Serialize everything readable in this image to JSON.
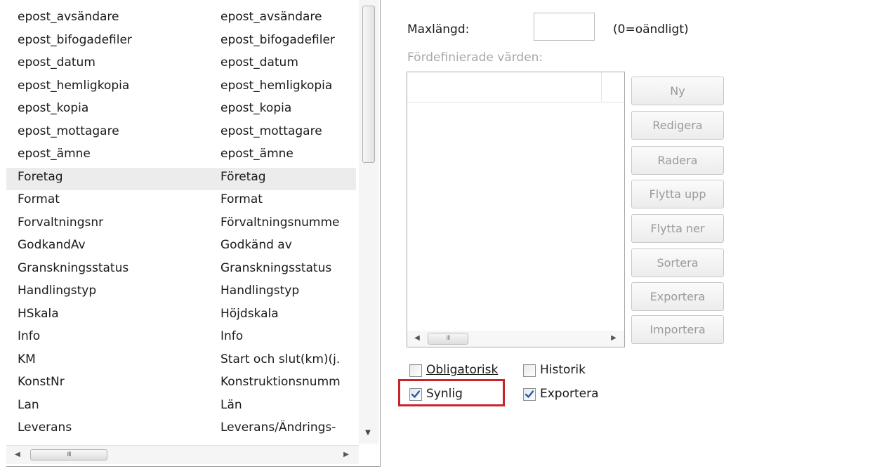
{
  "fields_list": {
    "rows": [
      {
        "name": "epost_avsändare",
        "display": "epost_avsändare"
      },
      {
        "name": "epost_bifogadefiler",
        "display": "epost_bifogadefiler"
      },
      {
        "name": "epost_datum",
        "display": "epost_datum"
      },
      {
        "name": "epost_hemligkopia",
        "display": "epost_hemligkopia"
      },
      {
        "name": "epost_kopia",
        "display": "epost_kopia"
      },
      {
        "name": "epost_mottagare",
        "display": "epost_mottagare"
      },
      {
        "name": "epost_ämne",
        "display": "epost_ämne"
      },
      {
        "name": "Foretag",
        "display": "Företag"
      },
      {
        "name": "Format",
        "display": "Format"
      },
      {
        "name": "Forvaltningsnr",
        "display": "Förvaltningsnumme"
      },
      {
        "name": "GodkandAv",
        "display": "Godkänd av"
      },
      {
        "name": "Granskningsstatus",
        "display": "Granskningsstatus"
      },
      {
        "name": "Handlingstyp",
        "display": "Handlingstyp"
      },
      {
        "name": "HSkala",
        "display": "Höjdskala"
      },
      {
        "name": "Info",
        "display": "Info"
      },
      {
        "name": "KM",
        "display": "Start och slut(km)(j."
      },
      {
        "name": "KonstNr",
        "display": "Konstruktionsnumm"
      },
      {
        "name": "Lan",
        "display": "Län"
      },
      {
        "name": "Leverans",
        "display": "Leverans/Ändrings-"
      }
    ],
    "selected_index": 7,
    "hscroll_thumb_glyph": "III"
  },
  "settings": {
    "maxlength_label": "Maxlängd:",
    "maxlength_value": "",
    "maxlength_hint": "(0=oändligt)",
    "predefined_label": "Fördefinierade värden:",
    "predefined_scroll_glyph": "III",
    "buttons": {
      "new": "Ny",
      "edit": "Redigera",
      "delete": "Radera",
      "move_up": "Flytta upp",
      "move_down": "Flytta ner",
      "sort": "Sortera",
      "export": "Exportera",
      "import": "Importera"
    },
    "checkboxes": {
      "mandatory": {
        "label": "Obligatorisk",
        "checked": false
      },
      "history": {
        "label": "Historik",
        "checked": false
      },
      "visible": {
        "label": "Synlig",
        "checked": true
      },
      "exportable": {
        "label": "Exportera",
        "checked": true
      }
    }
  },
  "colors": {
    "highlight": "#c8252b",
    "check_mark": "#2b5aa6"
  },
  "icons": {
    "scroll_left": "◀",
    "scroll_right": "▶",
    "scroll_down": "▼"
  }
}
